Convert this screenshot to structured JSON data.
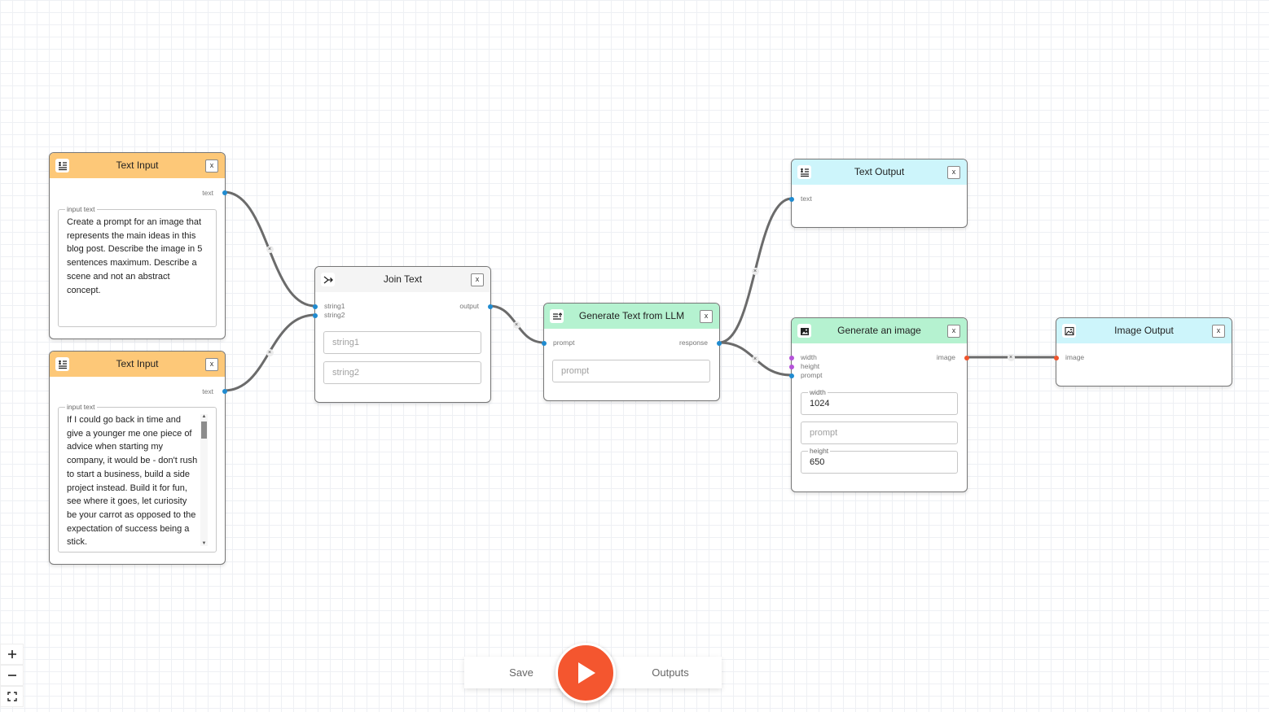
{
  "colors": {
    "text_input_header": "#fdc878",
    "join_text_header": "#f4f4f4",
    "llm_header": "#b5f2d0",
    "image_gen_header": "#b5f2d0",
    "output_header": "#cdf5fb",
    "port_text": "#1f8bd0",
    "port_number": "#b553d9",
    "port_image": "#f0542c",
    "run_button": "#f4562f"
  },
  "edge_remove_glyph": "×",
  "nodes": {
    "text_input_1": {
      "title": "Text Input",
      "icon": "text-lines-icon",
      "close": "x",
      "output_port": "text",
      "field_legend": "input text",
      "value": "Create a prompt for an image that represents the main ideas in this blog post. Describe the image in 5 sentences maximum. Describe a scene and not an abstract concept."
    },
    "text_input_2": {
      "title": "Text Input",
      "icon": "text-lines-icon",
      "close": "x",
      "output_port": "text",
      "field_legend": "input text",
      "value": "If I could go back in time and give a younger me one piece of advice when starting my company, it would be - don't rush to start a business, build a side project instead. Build it for fun, see where it goes, let curiosity be your carrot as opposed to the expectation of success being a stick."
    },
    "join_text": {
      "title": "Join Text",
      "icon": "merge-icon",
      "close": "x",
      "input_ports": [
        "string1",
        "string2"
      ],
      "output_port": "output",
      "fields": [
        {
          "placeholder": "string1"
        },
        {
          "placeholder": "string2"
        }
      ]
    },
    "llm": {
      "title": "Generate Text from LLM",
      "icon": "llm-text-icon",
      "close": "x",
      "input_port": "prompt",
      "output_port": "response",
      "field_placeholder": "prompt"
    },
    "text_output": {
      "title": "Text Output",
      "icon": "text-lines-icon",
      "close": "x",
      "input_port": "text"
    },
    "image_gen": {
      "title": "Generate an image",
      "icon": "image-generate-icon",
      "close": "x",
      "input_ports": [
        "width",
        "height",
        "prompt"
      ],
      "output_port": "image",
      "width_legend": "width",
      "width_value": "1024",
      "prompt_placeholder": "prompt",
      "height_legend": "height",
      "height_value": "650"
    },
    "image_output": {
      "title": "Image Output",
      "icon": "image-icon",
      "close": "x",
      "input_port": "image"
    }
  },
  "toolbar": {
    "save_label": "Save",
    "run_icon": "play-icon",
    "outputs_label": "Outputs"
  },
  "zoom_controls": [
    {
      "icon": "plus-icon"
    },
    {
      "icon": "minus-icon"
    },
    {
      "icon": "fit-view-icon"
    }
  ]
}
